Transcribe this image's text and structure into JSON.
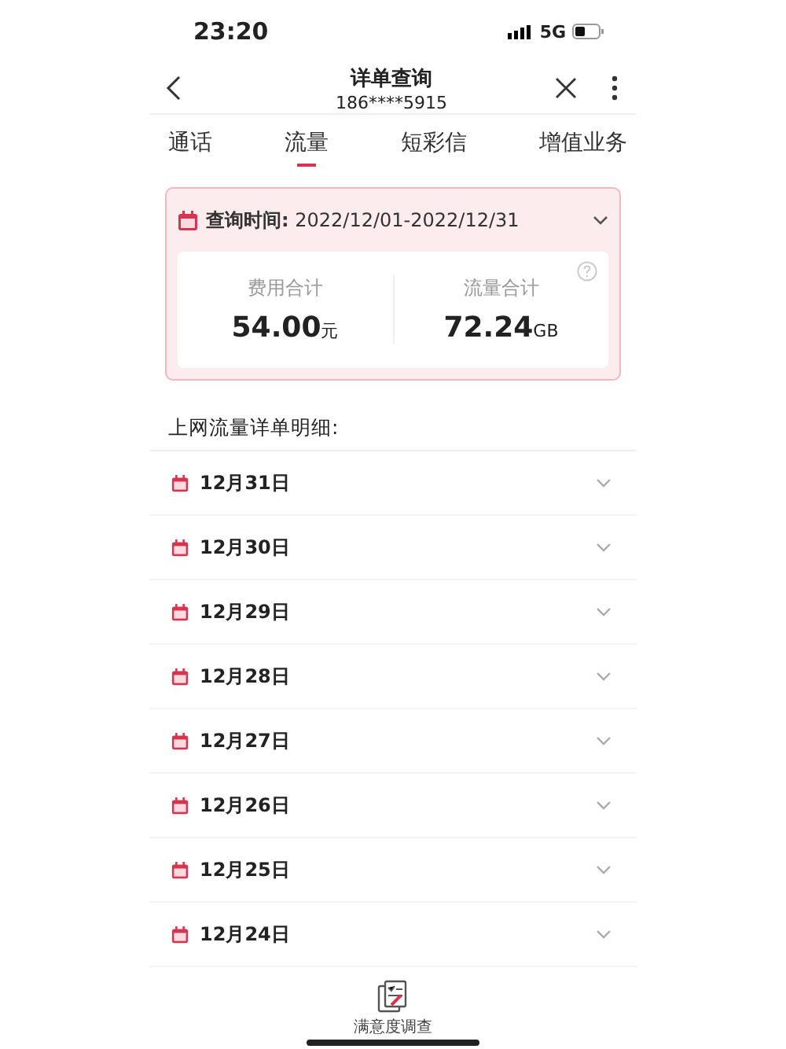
{
  "status_bar": {
    "time": "23:20",
    "network": "5G"
  },
  "header": {
    "title": "详单查询",
    "subtitle": "186****5915"
  },
  "tabs": [
    {
      "label": "通话",
      "selected": false
    },
    {
      "label": "流量",
      "selected": true
    },
    {
      "label": "短彩信",
      "selected": false
    },
    {
      "label": "增值业务",
      "selected": false
    }
  ],
  "summary": {
    "query_label": "查询时间:",
    "query_range": "2022/12/01-2022/12/31",
    "stats": [
      {
        "label": "费用合计",
        "value": "54.00",
        "unit": "元"
      },
      {
        "label": "流量合计",
        "value": "72.24",
        "unit": "GB"
      }
    ]
  },
  "section_title": "上网流量详单明细:",
  "days": [
    {
      "date": "12月31日",
      "expanded": false
    },
    {
      "date": "12月30日",
      "expanded": false
    },
    {
      "date": "12月29日",
      "expanded": false
    },
    {
      "date": "12月28日",
      "expanded": false
    },
    {
      "date": "12月27日",
      "expanded": false
    },
    {
      "date": "12月26日",
      "expanded": false
    },
    {
      "date": "12月25日",
      "expanded": false
    },
    {
      "date": "12月24日",
      "expanded": false
    }
  ],
  "survey_button": {
    "label": "满意度调查"
  }
}
